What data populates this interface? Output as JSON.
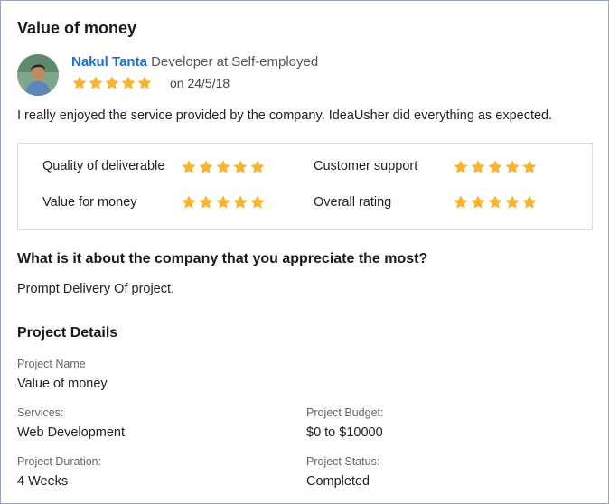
{
  "review": {
    "title": "Value of money",
    "reviewer_name": "Nakul Tanta",
    "reviewer_role": "Developer at Self-employed",
    "rating": 5,
    "date": "on 24/5/18",
    "text": "I really enjoyed the service provided by the company. IdeaUsher did everything as expected."
  },
  "ratings": [
    {
      "label": "Quality of deliverable",
      "stars": 5
    },
    {
      "label": "Customer support",
      "stars": 5
    },
    {
      "label": "Value for money",
      "stars": 5
    },
    {
      "label": "Overall rating",
      "stars": 5
    }
  ],
  "question": {
    "text": "What is it about the company that you appreciate the most?",
    "answer": "Prompt Delivery Of project."
  },
  "project_details": {
    "heading": "Project Details",
    "name_label": "Project Name",
    "name_value": "Value of money",
    "services_label": "Services:",
    "services_value": "Web Development",
    "budget_label": "Project Budget:",
    "budget_value": "$0 to $10000",
    "duration_label": "Project Duration:",
    "duration_value": "4 Weeks",
    "status_label": "Project Status:",
    "status_value": "Completed"
  },
  "colors": {
    "star": "#f7b531",
    "name_link": "#1e6fd0"
  }
}
